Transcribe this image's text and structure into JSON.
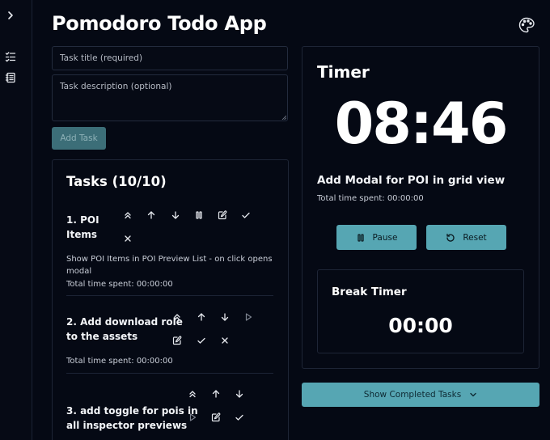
{
  "app": {
    "title": "Pomodoro Todo App"
  },
  "sidebar": {
    "icons": [
      "chevron-right-icon",
      "checklist-icon",
      "notebook-icon"
    ]
  },
  "form": {
    "title_placeholder": "Task title (required)",
    "description_placeholder": "Task description (optional)",
    "add_label": "Add Task"
  },
  "tasks": {
    "title": "Tasks (10/10)",
    "items": [
      {
        "name_line1": "1. POI",
        "name_line2": "Items",
        "desc_line1": "Show POI Items in POI Preview List - on click opens",
        "desc_line2": "modal",
        "time": "Total time spent: 00:00:00"
      },
      {
        "name_line1": "2. Add download role",
        "name_line2": "to the assets",
        "time": "Total time spent: 00:00:00"
      },
      {
        "name_line1": "3. add toggle for pois in",
        "name_line2": "all inspector previews"
      }
    ]
  },
  "timer": {
    "title": "Timer",
    "display": "08:46",
    "current_task": "Add Modal for POI in grid view",
    "total_time": "Total time spent: 00:00:00",
    "pause_label": "Pause",
    "reset_label": "Reset"
  },
  "break_timer": {
    "title": "Break Timer",
    "display": "00:00"
  },
  "completed": {
    "label": "Show Completed Tasks"
  },
  "colors": {
    "background": "#050914",
    "accent": "#56a6b3",
    "disabled": "#3c6e78"
  }
}
